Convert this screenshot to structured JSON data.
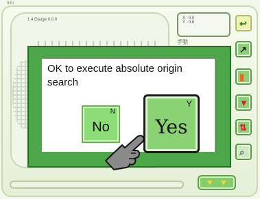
{
  "window": {
    "corner_label": "Info"
  },
  "background": {
    "panel_header": "1  4 Gauge                0.0.0",
    "side_box_lines": [
      "X : 0.0",
      "Y : 0.0"
    ],
    "side_text": "手動"
  },
  "dialog": {
    "message": "OK to execute absolute origin search",
    "no_button": {
      "label": "No",
      "key": "N"
    },
    "yes_button": {
      "label": "Yes",
      "key": "Y"
    }
  },
  "right_buttons": [
    {
      "icon": "back-arrow-icon",
      "glyph": "↩"
    },
    {
      "icon": "knife-icon",
      "glyph": "↗"
    },
    {
      "icon": "orange-tool-icon",
      "glyph": "▮"
    },
    {
      "icon": "red-marker-icon",
      "glyph": "▼"
    },
    {
      "icon": "up-down-arrows-icon",
      "glyph": "⇅"
    },
    {
      "icon": "zoom-icon",
      "glyph": "⌕"
    }
  ],
  "bottom": {
    "arrow_glyph": "▼"
  },
  "colors": {
    "dialog_border": "#4ea64b",
    "button_green": "#8cdc78",
    "arrow_yellow": "#f1d64a"
  }
}
